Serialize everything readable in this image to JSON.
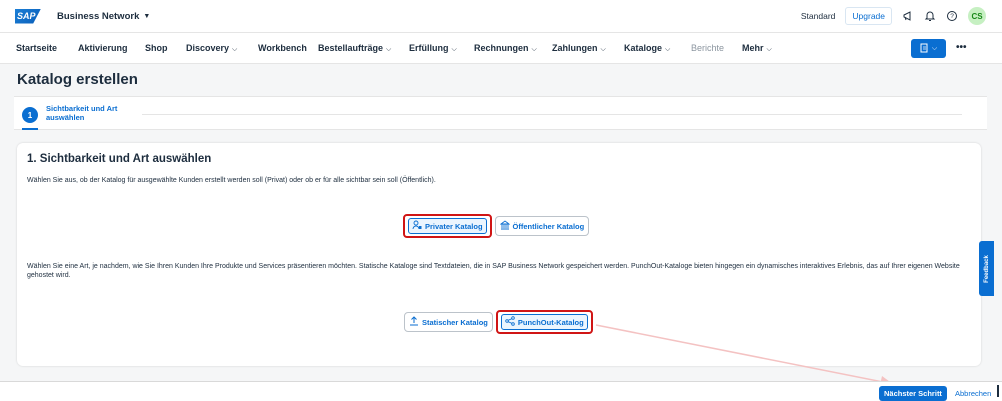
{
  "shell": {
    "logo": "SAP",
    "product": "Business Network",
    "standard": "Standard",
    "upgrade": "Upgrade",
    "avatar": "CS"
  },
  "nav": {
    "items": [
      {
        "label": "Startseite",
        "chevron": false,
        "disabled": false
      },
      {
        "label": "Aktivierung",
        "chevron": false,
        "disabled": false
      },
      {
        "label": "Shop",
        "chevron": false,
        "disabled": false
      },
      {
        "label": "Discovery",
        "chevron": true,
        "disabled": false
      },
      {
        "label": "Workbench",
        "chevron": false,
        "disabled": false
      },
      {
        "label": "Bestellaufträge",
        "chevron": true,
        "disabled": false
      },
      {
        "label": "Erfüllung",
        "chevron": true,
        "disabled": false
      },
      {
        "label": "Rechnungen",
        "chevron": true,
        "disabled": false
      },
      {
        "label": "Zahlungen",
        "chevron": true,
        "disabled": false
      },
      {
        "label": "Kataloge",
        "chevron": true,
        "disabled": false
      },
      {
        "label": "Berichte",
        "chevron": false,
        "disabled": true
      },
      {
        "label": "Mehr",
        "chevron": true,
        "disabled": false
      }
    ],
    "more": "•••"
  },
  "page": {
    "title": "Katalog erstellen"
  },
  "stepper": {
    "number": "1",
    "label": "Sichtbarkeit und Art auswählen"
  },
  "section": {
    "title": "1. Sichtbarkeit und Art auswählen",
    "visibility_text": "Wählen Sie aus, ob der Katalog für ausgewählte Kunden erstellt werden soll (Privat) oder ob er für alle sichtbar sein soll (Öffentlich).",
    "private_label": "Privater Katalog",
    "public_label": "Öffentlicher Katalog",
    "type_text": "Wählen Sie eine Art, je nachdem, wie Sie Ihren Kunden Ihre Produkte und Services präsentieren möchten. Statische Kataloge sind Textdateien, die in SAP Business Network gespeichert werden. PunchOut-Kataloge bieten hingegen ein dynamisches interaktives Erlebnis, das auf Ihrer eigenen Website gehostet wird.",
    "static_label": "Statischer Katalog",
    "punchout_label": "PunchOut-Katalog"
  },
  "feedback": "Feedback",
  "footer": {
    "next": "Nächster Schritt",
    "cancel": "Abbrechen"
  },
  "colors": {
    "accent": "#0a6ed1",
    "highlight": "#d01515",
    "arrow": "#f2b8b8"
  }
}
